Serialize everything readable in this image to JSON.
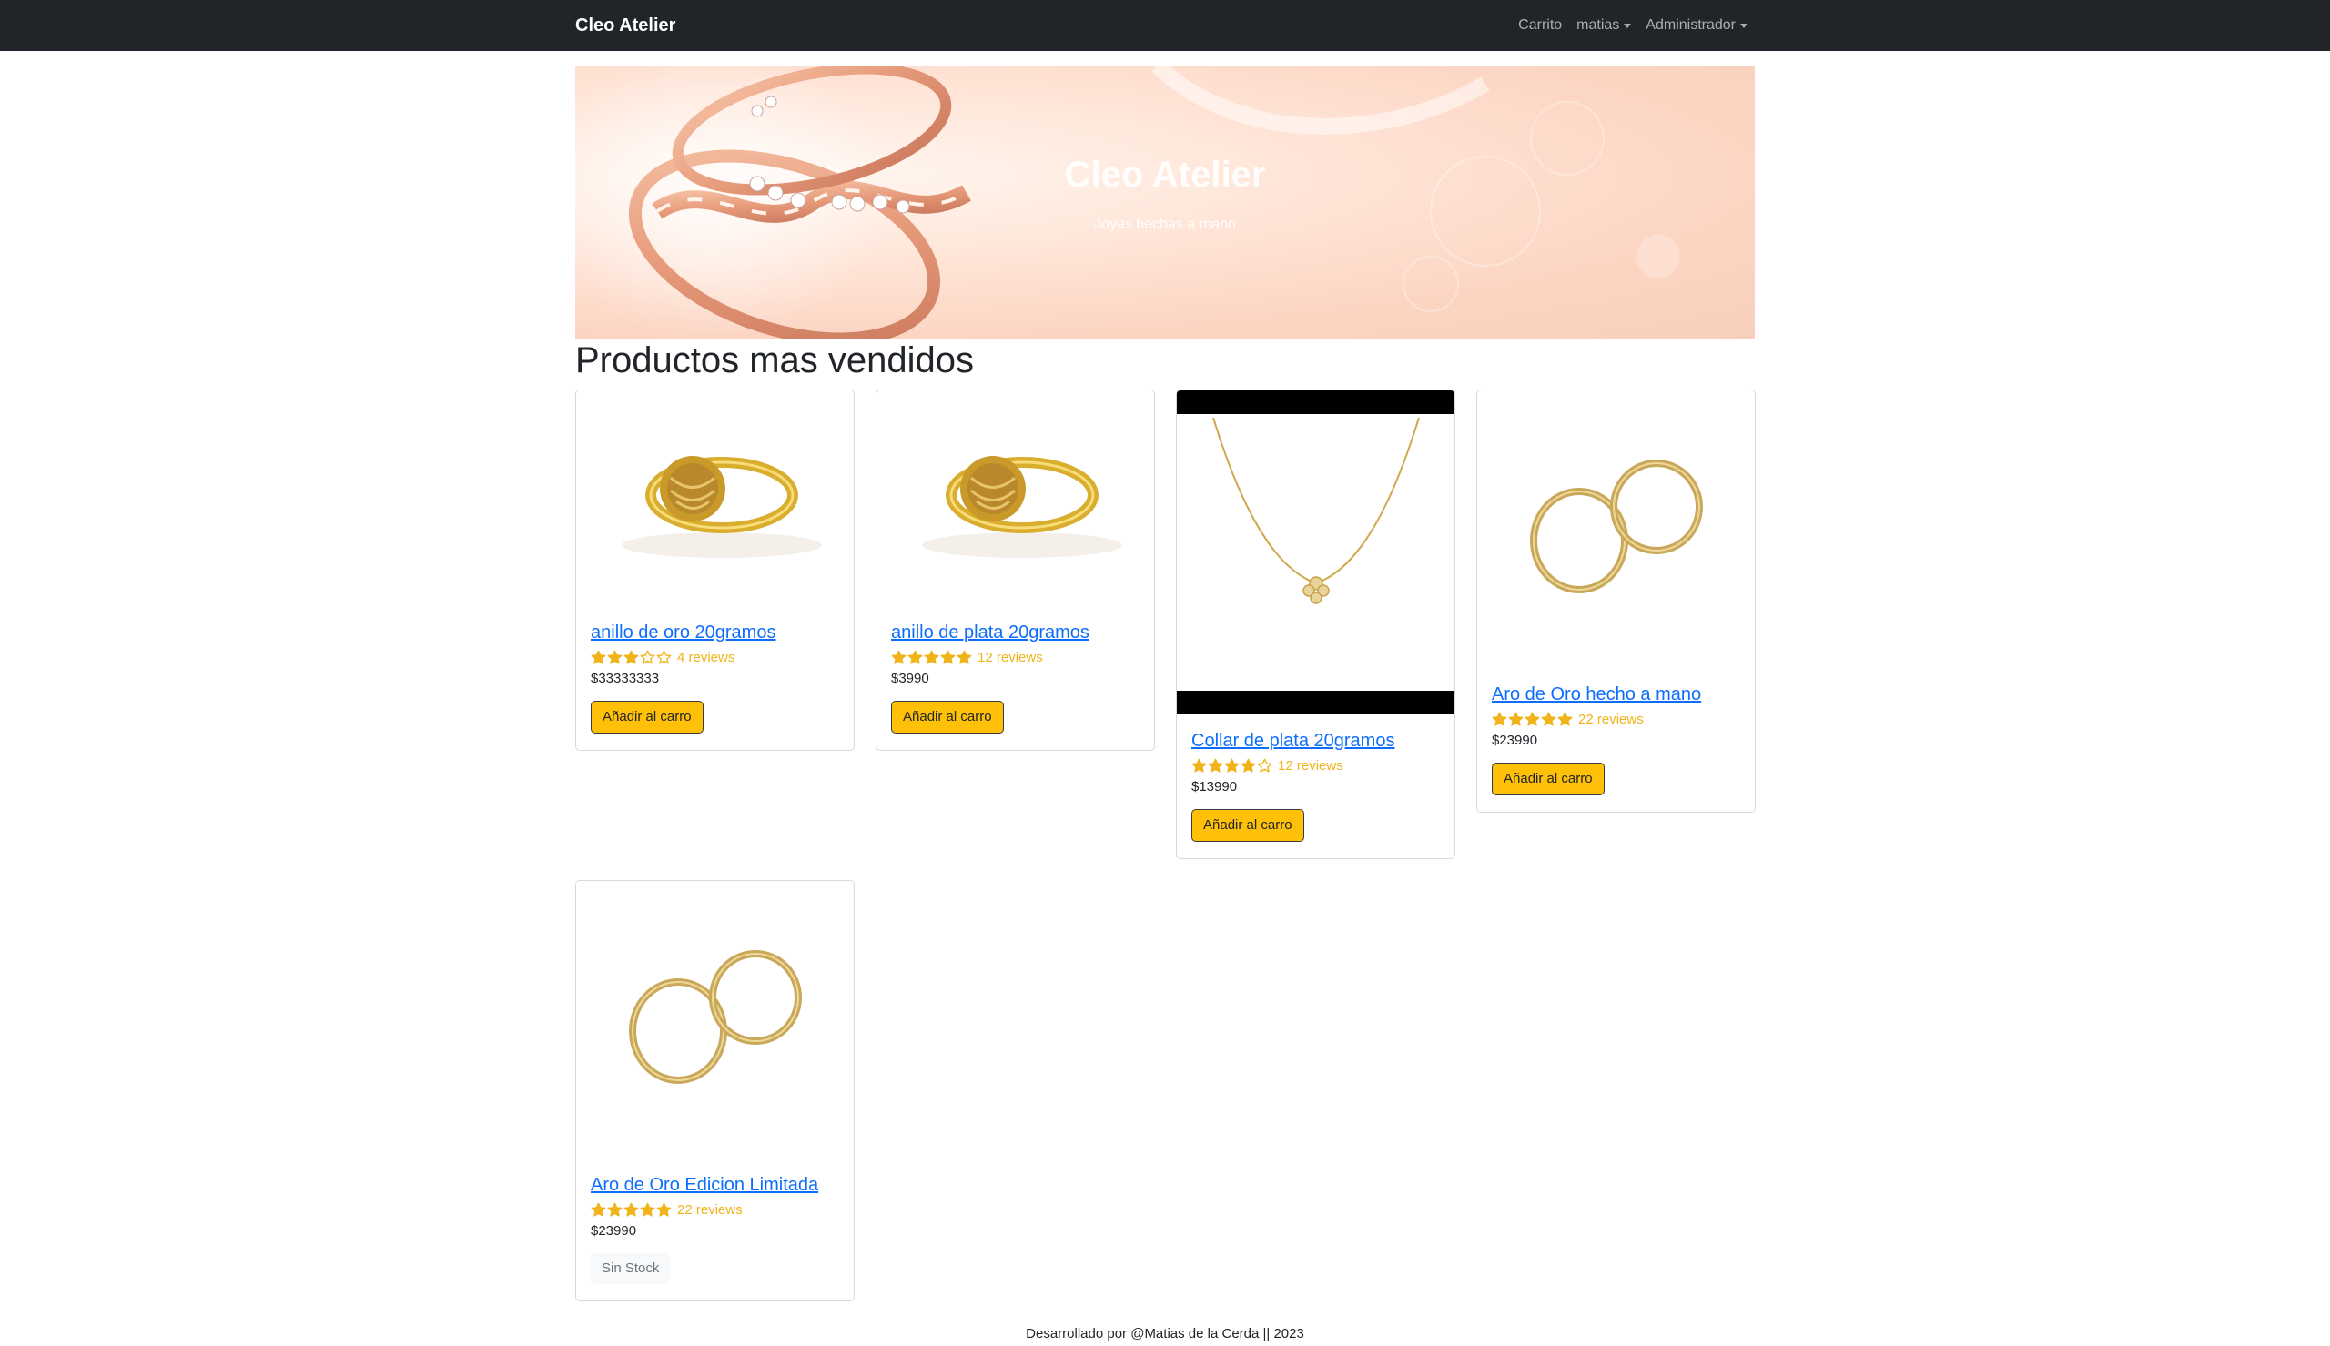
{
  "navbar": {
    "brand": "Cleo Atelier",
    "links": [
      {
        "label": "Carrito",
        "dropdown": false
      },
      {
        "label": "matias",
        "dropdown": true
      },
      {
        "label": "Administrador",
        "dropdown": true
      }
    ]
  },
  "hero": {
    "title": "Cleo Atelier",
    "subtitle": "Joyas hechas a mano"
  },
  "section_title": "Productos mas vendidos",
  "products": [
    {
      "name": "anillo de oro 20gramos",
      "rating": 3,
      "reviews": "4 reviews",
      "price": "$33333333",
      "action": "Añadir al carro",
      "image": "gold-ring"
    },
    {
      "name": "anillo de plata 20gramos",
      "rating": 5,
      "reviews": "12 reviews",
      "price": "$3990",
      "action": "Añadir al carro",
      "image": "gold-ring"
    },
    {
      "name": "Collar de plata 20gramos",
      "rating": 4,
      "reviews": "12 reviews",
      "price": "$13990",
      "action": "Añadir al carro",
      "image": "necklace"
    },
    {
      "name": "Aro de Oro hecho a mano",
      "rating": 5,
      "reviews": "22 reviews",
      "price": "$23990",
      "action": "Añadir al carro",
      "image": "hoop-earrings"
    },
    {
      "name": "Aro de Oro Edicion Limitada",
      "rating": 5,
      "reviews": "22 reviews",
      "price": "$23990",
      "action": "Sin Stock",
      "image": "hoop-earrings"
    }
  ],
  "footer": "Desarrollado por @Matias de la Cerda || 2023",
  "colors": {
    "navbar": "#212529",
    "accent": "#ffc107",
    "link": "#0d6efd",
    "star": "#f0b41a"
  }
}
